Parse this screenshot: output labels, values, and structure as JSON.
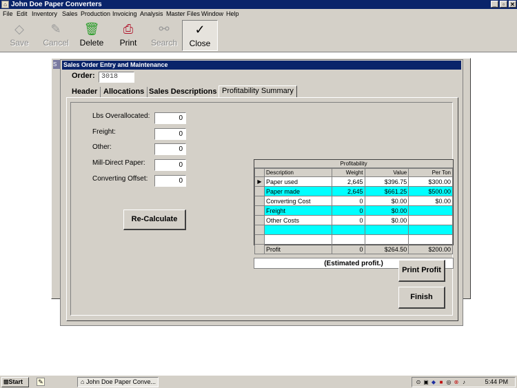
{
  "app": {
    "title": "John Doe Paper Converters",
    "window_controls": [
      "_",
      "▫",
      "✕"
    ]
  },
  "menu": [
    "File",
    "Edit",
    "Inventory",
    "Sales",
    "Production",
    "Invoicing",
    "Analysis",
    "Master Files",
    "Window",
    "Help"
  ],
  "toolbar": {
    "save": "Save",
    "cancel": "Cancel",
    "delete": "Delete",
    "print": "Print",
    "search": "Search",
    "close": "Close"
  },
  "bg_window": {
    "title_stub": "S"
  },
  "form": {
    "title": "Sales Order Entry and Maintenance",
    "order_label": "Order:",
    "order_value": "3018",
    "tabs": [
      "Header",
      "Allocations",
      "Sales Descriptions",
      "Profitability Summary"
    ],
    "fields": [
      {
        "label": "Lbs Overallocated:",
        "value": "0"
      },
      {
        "label": "Freight:",
        "value": "0"
      },
      {
        "label": "Other:",
        "value": "0"
      },
      {
        "label": "Mill-Direct Paper:",
        "value": "0"
      },
      {
        "label": "Converting Offset:",
        "value": "0"
      }
    ],
    "recalc_label": "Re-Calculate",
    "print_profit_label": "Print Profit",
    "finish_label": "Finish",
    "estimate_text": "(Estimated profit.)"
  },
  "grid": {
    "title": "Profitability",
    "columns": [
      "Description",
      "Weight",
      "Value",
      "Per Ton"
    ],
    "rows": [
      {
        "desc": "Paper used",
        "weight": "2,645",
        "value": "$396.75",
        "per_ton": "$300.00",
        "highlight": false,
        "current": true
      },
      {
        "desc": "Paper made",
        "weight": "2,645",
        "value": "$661.25",
        "per_ton": "$500.00",
        "highlight": true,
        "current": false
      },
      {
        "desc": "Converting Cost",
        "weight": "0",
        "value": "$0.00",
        "per_ton": "$0.00",
        "highlight": false,
        "current": false
      },
      {
        "desc": "Freight",
        "weight": "0",
        "value": "$0.00",
        "per_ton": "",
        "highlight": true,
        "current": false
      },
      {
        "desc": "Other Costs",
        "weight": "0",
        "value": "$0.00",
        "per_ton": "",
        "highlight": false,
        "current": false
      },
      {
        "desc": "",
        "weight": "",
        "value": "",
        "per_ton": "",
        "highlight": true,
        "current": false
      },
      {
        "desc": "",
        "weight": "",
        "value": "",
        "per_ton": "",
        "highlight": false,
        "current": false
      },
      {
        "desc": "Profit",
        "weight": "0",
        "value": "$264.50",
        "per_ton": "$200.00",
        "highlight": false,
        "current": false
      }
    ],
    "current_row_marker": "▶"
  },
  "taskbar": {
    "start_label": "Start",
    "app_label": "John Doe Paper Conve...",
    "clock": "5:44 PM"
  },
  "colors": {
    "titlebar": "#0a246a",
    "highlight_row": "#00ffff",
    "face": "#d4d0c8"
  }
}
